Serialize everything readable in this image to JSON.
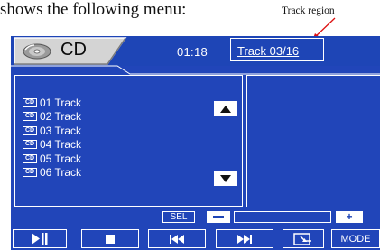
{
  "caption": "shows the following menu:",
  "callout": "Track region",
  "header": {
    "source_label": "CD",
    "time": "01:18",
    "track": "Track 03/16"
  },
  "tracks": [
    {
      "chip": "CD",
      "name": "01 Track"
    },
    {
      "chip": "CD",
      "name": "02 Track"
    },
    {
      "chip": "CD",
      "name": "03 Track"
    },
    {
      "chip": "CD",
      "name": "04 Track"
    },
    {
      "chip": "CD",
      "name": "05 Track"
    },
    {
      "chip": "CD",
      "name": "06 Track"
    }
  ],
  "adjust": {
    "sel_label": "SEL",
    "plus_label": "+",
    "level_fraction": 0.0
  },
  "controls": {
    "mode_label": "MODE",
    "icons": [
      "play-pause-icon",
      "stop-icon",
      "previous-track-icon",
      "next-track-icon",
      "return-icon"
    ]
  },
  "colors": {
    "screen_background": "#2145b9",
    "foreground": "#ffffff"
  }
}
